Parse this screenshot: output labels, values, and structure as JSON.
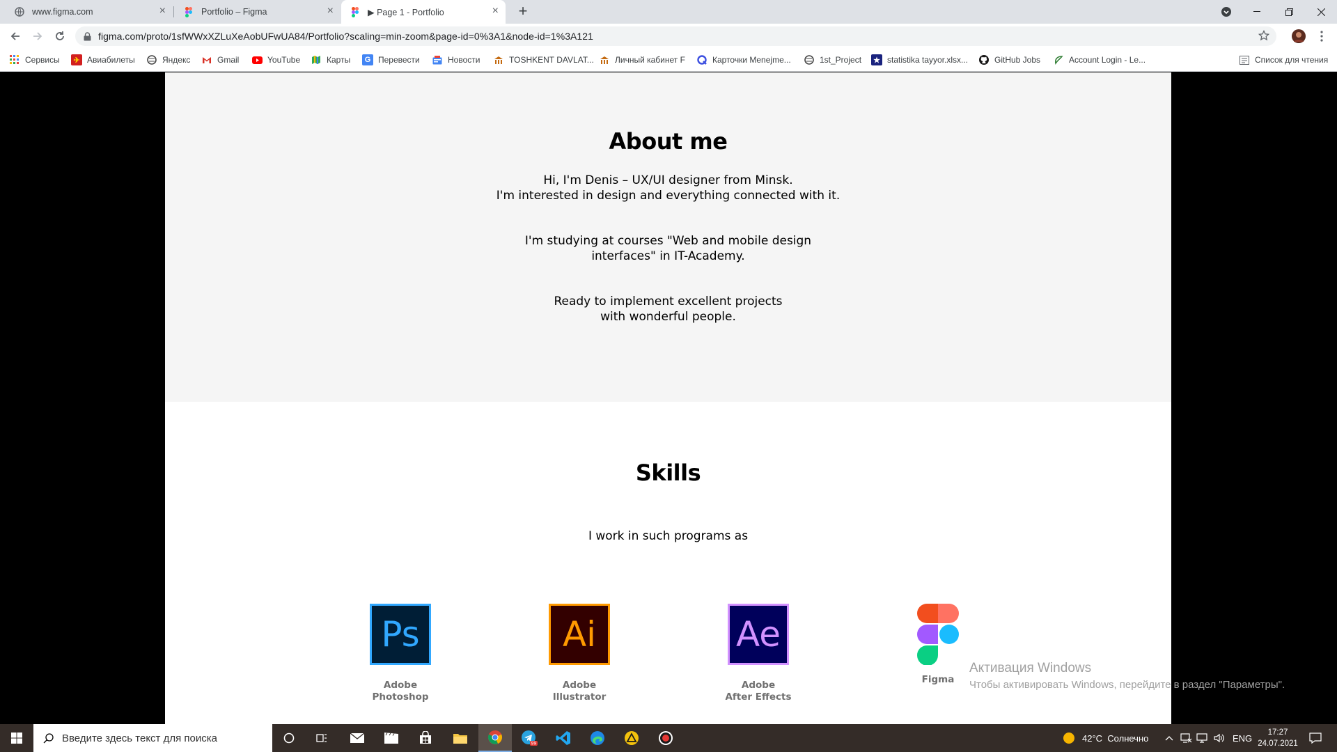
{
  "browser": {
    "tabs": [
      {
        "title": "www.figma.com",
        "icon": "globe-icon"
      },
      {
        "title": "Portfolio – Figma",
        "icon": "figma-icon"
      },
      {
        "title": "▶ Page 1 - Portfolio",
        "icon": "figma-icon",
        "active": true
      }
    ],
    "url": "figma.com/proto/1sfWWxXZLuXeAobUFwUA84/Portfolio?scaling=min-zoom&page-id=0%3A1&node-id=1%3A121",
    "bookmarks": [
      {
        "label": "Сервисы",
        "icon": "apps-grid-icon"
      },
      {
        "label": "Авиабилеты",
        "icon": "flag-icon"
      },
      {
        "label": "Яндекс",
        "icon": "globe-icon"
      },
      {
        "label": "Gmail",
        "icon": "gmail-icon"
      },
      {
        "label": "YouTube",
        "icon": "youtube-icon"
      },
      {
        "label": "Карты",
        "icon": "maps-icon"
      },
      {
        "label": "Перевести",
        "icon": "translate-icon"
      },
      {
        "label": "Новости",
        "icon": "news-icon"
      },
      {
        "label": "TOSHKENT DAVLAT...",
        "icon": "university-icon"
      },
      {
        "label": "Личный кабинет F",
        "icon": "university-icon"
      },
      {
        "label": "Карточки Menejme...",
        "icon": "quizlet-icon"
      },
      {
        "label": "1st_Project",
        "icon": "globe-icon"
      },
      {
        "label": "statistika tayyor.xlsx...",
        "icon": "star-shield-icon"
      },
      {
        "label": "GitHub Jobs",
        "icon": "github-icon"
      },
      {
        "label": "Account Login - Le...",
        "icon": "leaf-icon"
      }
    ],
    "reading_list": "Список для чтения"
  },
  "page": {
    "about": {
      "title": "About me",
      "p1_line1": "Hi, I'm Denis – UX/UI designer from Minsk.",
      "p1_line2": "I'm interested in design and everything connected with it.",
      "p2_line1": "I'm studying at courses \"Web and mobile design",
      "p2_line2": "interfaces\" in IT-Academy.",
      "p3_line1": "Ready to implement excellent projects",
      "p3_line2": "with wonderful people."
    },
    "skills": {
      "title": "Skills",
      "subtitle": "I work in such programs as",
      "items": [
        {
          "abbr": "Ps",
          "line1": "Adobe",
          "line2": "Photoshop",
          "fg": "#31a8ff",
          "bg": "#001e36"
        },
        {
          "abbr": "Ai",
          "line1": "Adobe",
          "line2": "Illustrator",
          "fg": "#ff9a00",
          "bg": "#330000"
        },
        {
          "abbr": "Ae",
          "line1": "Adobe",
          "line2": "After Effects",
          "fg": "#d291ff",
          "bg": "#00005b"
        },
        {
          "abbr": "",
          "line1": "Figma",
          "line2": ""
        }
      ]
    }
  },
  "watermark": {
    "line1": "Активация Windows",
    "line2": "Чтобы активировать Windows, перейдите в раздел \"Параметры\"."
  },
  "taskbar": {
    "search_placeholder": "Введите здесь текст для поиска",
    "weather": "42°C  Солнечно",
    "lang": "ENG",
    "time": "17:27",
    "date": "24.07.2021"
  }
}
